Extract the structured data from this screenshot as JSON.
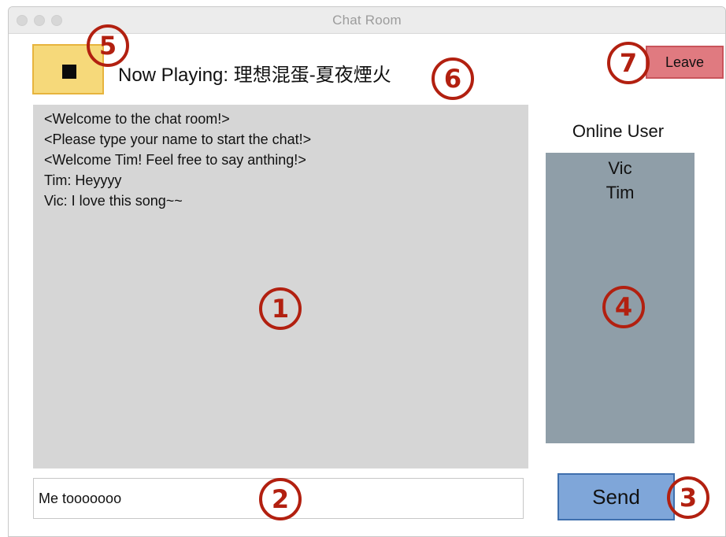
{
  "window": {
    "title": "Chat Room"
  },
  "player": {
    "button_icon": "stop-icon",
    "now_playing": "Now Playing: 理想混蛋-夏夜煙火"
  },
  "leave": {
    "label": "Leave"
  },
  "chat": {
    "messages": [
      "<Welcome to the chat room!>",
      "<Please type your name to start the chat!>",
      "<Welcome Tim! Feel free to say anthing!>",
      "Tim: Heyyyy",
      "Vic: I love this song~~"
    ]
  },
  "online": {
    "title": "Online User",
    "users": [
      "Vic",
      "Tim"
    ]
  },
  "input": {
    "value": "Me tooooooo"
  },
  "send": {
    "label": "Send"
  },
  "callouts": [
    "1",
    "2",
    "3",
    "4",
    "5",
    "6",
    "7"
  ],
  "colors": {
    "callout": "#b22010",
    "music_button": "#f6d97a",
    "leave_button": "#e07a80",
    "send_button": "#7fa6d9",
    "chat_background": "#d6d6d6",
    "user_list_background": "#8f9ea8"
  }
}
